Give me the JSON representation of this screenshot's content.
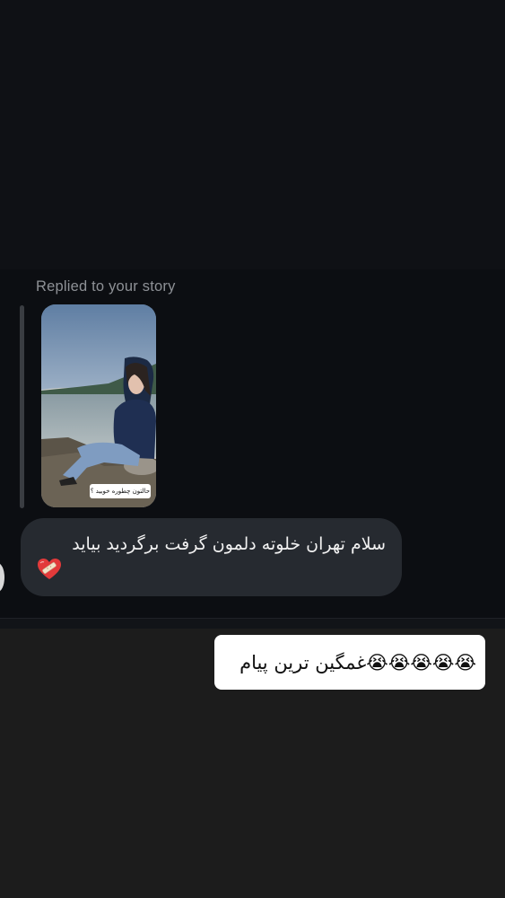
{
  "thread": {
    "replied_label": "Replied to your story",
    "story": {
      "sticker_text": "حالتون چطوره خوبید ؟",
      "image_description_icon": "story-photo-woman-by-lake"
    },
    "message": {
      "text": "سلام تهران خلوته دلمون گرفت برگردید بیاید",
      "emoji_icon": "mending-heart-icon"
    }
  },
  "overlay": {
    "caption": "😭😭😭😭😭غمگین ترین پیام"
  },
  "colors": {
    "top_background": "#0f1115",
    "chat_background": "#0c0e12",
    "bubble": "#262a30",
    "bottom_background": "#1c1c1c",
    "caption_box": "#ffffff"
  }
}
